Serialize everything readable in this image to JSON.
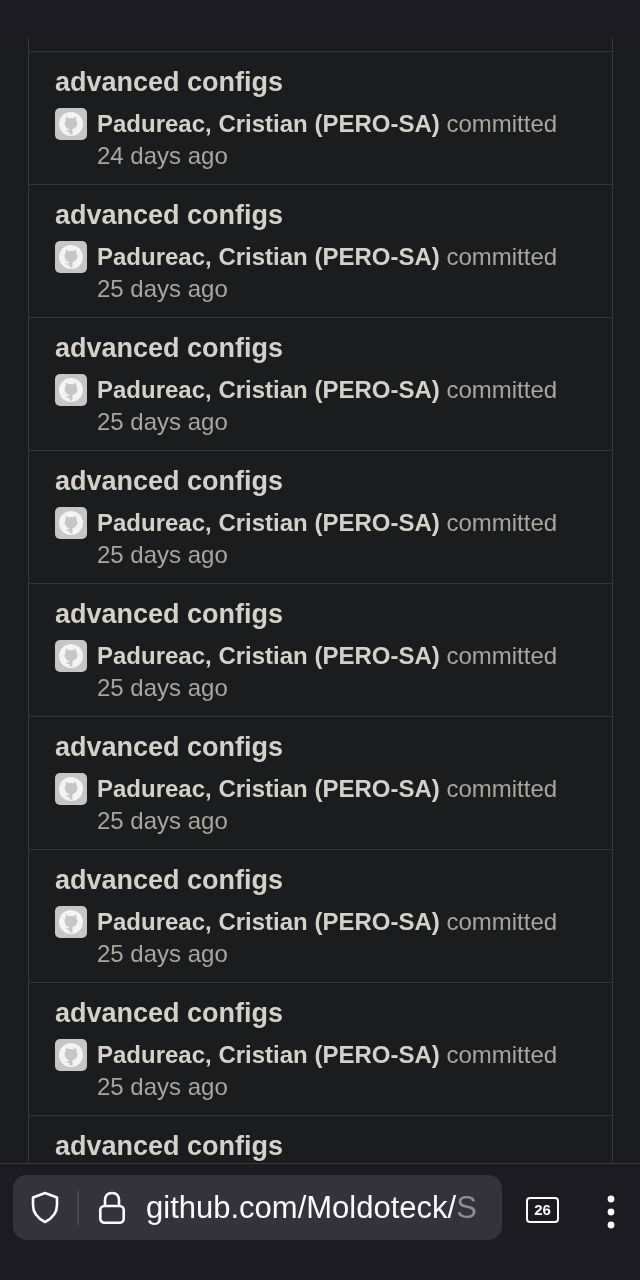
{
  "commits": [
    {
      "title": "advanced configs",
      "author": "Padureac, Cristian (PERO-SA)",
      "action": "committed",
      "time": "24 days ago"
    },
    {
      "title": "advanced configs",
      "author": "Padureac, Cristian (PERO-SA)",
      "action": "committed",
      "time": "25 days ago"
    },
    {
      "title": "advanced configs",
      "author": "Padureac, Cristian (PERO-SA)",
      "action": "committed",
      "time": "25 days ago"
    },
    {
      "title": "advanced configs",
      "author": "Padureac, Cristian (PERO-SA)",
      "action": "committed",
      "time": "25 days ago"
    },
    {
      "title": "advanced configs",
      "author": "Padureac, Cristian (PERO-SA)",
      "action": "committed",
      "time": "25 days ago"
    },
    {
      "title": "advanced configs",
      "author": "Padureac, Cristian (PERO-SA)",
      "action": "committed",
      "time": "25 days ago"
    },
    {
      "title": "advanced configs",
      "author": "Padureac, Cristian (PERO-SA)",
      "action": "committed",
      "time": "25 days ago"
    },
    {
      "title": "advanced configs",
      "author": "Padureac, Cristian (PERO-SA)",
      "action": "committed",
      "time": "25 days ago"
    },
    {
      "title": "advanced configs"
    }
  ],
  "toolbar": {
    "url": "github.com/Moldoteck/",
    "url_faded": "S",
    "tab_count": "26"
  }
}
